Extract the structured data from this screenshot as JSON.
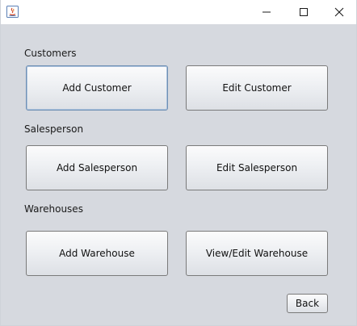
{
  "window": {
    "icon": "java-app-icon",
    "controls": {
      "minimize_icon": "minimize-icon",
      "maximize_icon": "maximize-icon",
      "close_icon": "close-icon"
    }
  },
  "sections": {
    "customers": {
      "label": "Customers",
      "add_label": "Add Customer",
      "edit_label": "Edit Customer"
    },
    "salesperson": {
      "label": "Salesperson",
      "add_label": "Add Salesperson",
      "edit_label": "Edit Salesperson"
    },
    "warehouses": {
      "label": "Warehouses",
      "add_label": "Add Warehouse",
      "edit_label": "View/Edit Warehouse"
    }
  },
  "footer": {
    "back_label": "Back"
  },
  "colors": {
    "background": "#d6d9df",
    "titlebar": "#ffffff",
    "focus_border": "#6f8fb3"
  }
}
